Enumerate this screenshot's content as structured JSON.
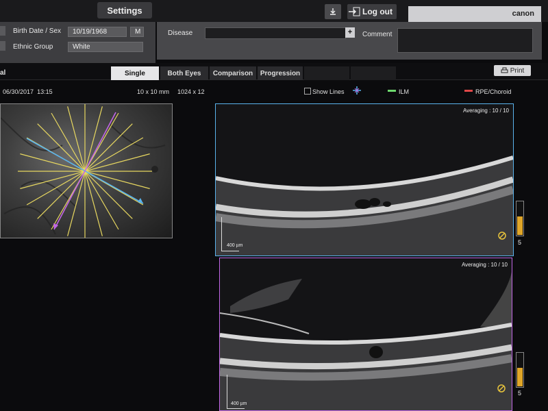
{
  "header": {
    "settings_label": "Settings",
    "logout_label": "Log out",
    "brand": "canon"
  },
  "patient": {
    "birth_label": "Birth Date / Sex",
    "birth_value": "10/19/1968",
    "sex_value": "M",
    "ethnic_label": "Ethnic Group",
    "ethnic_value": "White",
    "disease_label": "Disease",
    "disease_add": "+",
    "comment_label": "Comment"
  },
  "tabs": {
    "partial_label": "al",
    "items": [
      "Single",
      "Both Eyes",
      "Comparison",
      "Progression"
    ],
    "print_label": "Print"
  },
  "scan_info": {
    "date": "06/30/2017",
    "time": "13:15",
    "area": "10 x 10 mm",
    "resolution": "1024 x 12",
    "show_lines": "Show Lines",
    "ilm_label": "ILM",
    "rpe_label": "RPE/Choroid"
  },
  "bscans": [
    {
      "averaging": "Averaging : 10 / 10",
      "scale": "400 µm",
      "gauge_value": "5"
    },
    {
      "averaging": "Averaging : 10 / 10",
      "scale": "400 µm",
      "gauge_value": "5"
    }
  ],
  "colors": {
    "accent_blue": "#5ab4ee",
    "accent_purple": "#c266e6",
    "ilm": "#6dd86d",
    "rpe": "#e04848",
    "scan_lines": "#e8d860"
  }
}
